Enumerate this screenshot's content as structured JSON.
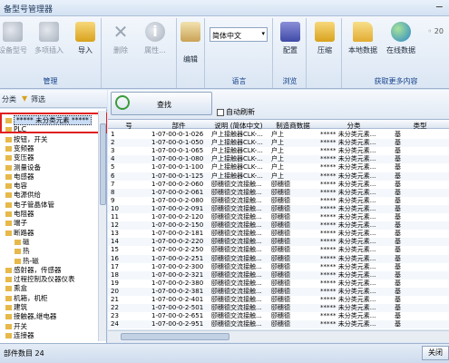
{
  "window": {
    "title": "备型号管理器",
    "min_glyph": "−"
  },
  "ribbon": {
    "manage_group": "管理",
    "buttons": {
      "single": "设备型号",
      "multi": "多项插入",
      "import": "导入",
      "delete": "删除",
      "props": "属性..."
    },
    "edit": "编辑",
    "language_group": "语言",
    "language_value": "简体中文",
    "config": "配置",
    "browse_group": "浏览",
    "compress": "压缩",
    "local": "本地数据",
    "online": "在线数据",
    "more_group": "获取更多内容",
    "hint": "◦ 20"
  },
  "left_toolbar": {
    "classify": "分类",
    "filter": "筛选"
  },
  "tree": [
    {
      "label": "***** 未分类元素 *****",
      "selected": true
    },
    {
      "label": "PLC"
    },
    {
      "label": "按钮，开关"
    },
    {
      "label": "变频器"
    },
    {
      "label": "变压器"
    },
    {
      "label": "测量设备"
    },
    {
      "label": "电感器"
    },
    {
      "label": "电容"
    },
    {
      "label": "电源供给"
    },
    {
      "label": "电子管晶体管"
    },
    {
      "label": "电阻器"
    },
    {
      "label": "端子"
    },
    {
      "label": "断路器"
    },
    {
      "label": "磁",
      "indent": 1
    },
    {
      "label": "热",
      "indent": 1
    },
    {
      "label": "热-磁",
      "indent": 1
    },
    {
      "label": "感射器，传感器"
    },
    {
      "label": "过程控制及仪器仪表"
    },
    {
      "label": "熏盒"
    },
    {
      "label": "机箱，机柜"
    },
    {
      "label": "建筑"
    },
    {
      "label": "接触器,继电器"
    },
    {
      "label": "开关"
    },
    {
      "label": "连接器"
    }
  ],
  "search": {
    "find_label": "查找",
    "auto_refresh": "自动刷新"
  },
  "grid": {
    "headers": [
      "号",
      "部件",
      "说明 (简体中文)",
      "制造商数据",
      "分类",
      "类型"
    ],
    "rows": [
      [
        "1",
        "1-07-00-0-1-026",
        "户上接触器CLK-...",
        "户上",
        "***** 未分类元素...",
        "基"
      ],
      [
        "2",
        "1-07-00-0-1-050",
        "户上接触器CLK-...",
        "户上",
        "***** 未分类元素...",
        "基"
      ],
      [
        "3",
        "1-07-00-0-1-065",
        "户上接触器CLK-...",
        "户上",
        "***** 未分类元素...",
        "基"
      ],
      [
        "4",
        "1-07-00-0-1-080",
        "户上接触器CLK-...",
        "户上",
        "***** 未分类元素...",
        "基"
      ],
      [
        "5",
        "1-07-00-0-1-100",
        "户上接触器CLK-...",
        "户上",
        "***** 未分类元素...",
        "基"
      ],
      [
        "6",
        "1-07-00-0-1-125",
        "户上接触器CLK-...",
        "户上",
        "***** 未分类元素...",
        "基"
      ],
      [
        "7",
        "1-07-00-0-2-060",
        "颐穗德交流接触...",
        "颐穗德",
        "***** 未分类元素...",
        "基"
      ],
      [
        "8",
        "1-07-00-0-2-061",
        "颐穗德交流接触...",
        "颐穗德",
        "***** 未分类元素...",
        "基"
      ],
      [
        "9",
        "1-07-00-0-2-080",
        "颐穗德交流接触...",
        "颐穗德",
        "***** 未分类元素...",
        "基"
      ],
      [
        "10",
        "1-07-00-0-2-091",
        "颐穗德交流接触...",
        "颐穗德",
        "***** 未分类元素...",
        "基"
      ],
      [
        "11",
        "1-07-00-0-2-120",
        "颐穗德交流接触...",
        "颐穗德",
        "***** 未分类元素...",
        "基"
      ],
      [
        "12",
        "1-07-00-0-2-150",
        "颐穗德交流接触...",
        "颐穗德",
        "***** 未分类元素...",
        "基"
      ],
      [
        "13",
        "1-07-00-0-2-181",
        "颐穗德交流接触...",
        "颐穗德",
        "***** 未分类元素...",
        "基"
      ],
      [
        "14",
        "1-07-00-0-2-220",
        "颐穗德交流接触...",
        "颐穗德",
        "***** 未分类元素...",
        "基"
      ],
      [
        "15",
        "1-07-00-0-2-250",
        "颐穗德交流接触...",
        "颐穗德",
        "***** 未分类元素...",
        "基"
      ],
      [
        "16",
        "1-07-00-0-2-251",
        "颐穗德交流接触...",
        "颐穗德",
        "***** 未分类元素...",
        "基"
      ],
      [
        "17",
        "1-07-00-0-2-300",
        "颐穗德交流接触...",
        "颐穗德",
        "***** 未分类元素...",
        "基"
      ],
      [
        "18",
        "1-07-00-0-2-321",
        "颐穗德交流接触...",
        "颐穗德",
        "***** 未分类元素...",
        "基"
      ],
      [
        "19",
        "1-07-00-0-2-380",
        "颐穗德交流接触...",
        "颐穗德",
        "***** 未分类元素...",
        "基"
      ],
      [
        "20",
        "1-07-00-0-2-381",
        "颐穗德交流接触...",
        "颐穗德",
        "***** 未分类元素...",
        "基"
      ],
      [
        "21",
        "1-07-00-0-2-401",
        "颐穗德交流接触...",
        "颐穗德",
        "***** 未分类元素...",
        "基"
      ],
      [
        "22",
        "1-07-00-0-2-501",
        "颐穗德交流接触...",
        "颐穗德",
        "***** 未分类元素...",
        "基"
      ],
      [
        "23",
        "1-07-00-0-2-651",
        "颐穗德交流接触...",
        "颐穗德",
        "***** 未分类元素...",
        "基"
      ],
      [
        "24",
        "1-07-00-0-2-951",
        "颐穗德交流接触...",
        "颐穗德",
        "***** 未分类元素...",
        "基"
      ]
    ]
  },
  "status": {
    "count_text": "部件数目  24",
    "close": "关闭"
  }
}
